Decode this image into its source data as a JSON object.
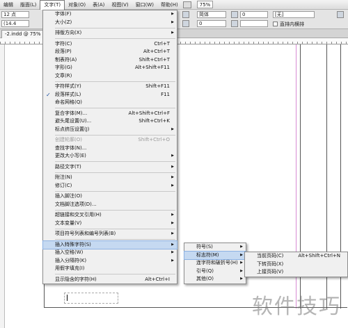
{
  "menubar": {
    "items": [
      "编辑",
      "版面(L)",
      "文字(T)",
      "对象(O)",
      "表(A)",
      "视图(V)",
      "窗口(W)",
      "帮助(H)"
    ],
    "active_index": 2,
    "zoom": "75%"
  },
  "controlbar": {
    "font_size": "12 点",
    "leading": "(14.4",
    "underline_style": "[无]",
    "lang_box": "简体",
    "number_box": "0",
    "ruby_label": "直排内横排",
    "char_style_value": "0"
  },
  "tab": {
    "label": "-2.indd @ 75%"
  },
  "type_menu": {
    "items": [
      {
        "label": "字体(F)",
        "shortcut": "",
        "submenu": true
      },
      {
        "label": "大小(Z)",
        "shortcut": "",
        "submenu": true
      },
      {
        "sep": true
      },
      {
        "label": "排版方向(X)",
        "shortcut": "",
        "submenu": true
      },
      {
        "sep": true
      },
      {
        "label": "字符(C)",
        "shortcut": "Ctrl+T"
      },
      {
        "label": "段落(P)",
        "shortcut": "Alt+Ctrl+T"
      },
      {
        "label": "制表符(A)",
        "shortcut": "Shift+Ctrl+T"
      },
      {
        "label": "字形(G)",
        "shortcut": "Alt+Shift+F11"
      },
      {
        "label": "文章(R)",
        "shortcut": ""
      },
      {
        "sep": true
      },
      {
        "label": "字符样式(Y)",
        "shortcut": "Shift+F11"
      },
      {
        "label": "段落样式(L)",
        "shortcut": "F11",
        "checked": true
      },
      {
        "label": "命名网格(Q)",
        "shortcut": ""
      },
      {
        "sep": true
      },
      {
        "label": "复合字体(M)...",
        "shortcut": "Alt+Shift+Ctrl+F"
      },
      {
        "label": "避头尾设置(U)...",
        "shortcut": "Shift+Ctrl+K"
      },
      {
        "label": "标点挤压设置(J)",
        "shortcut": "",
        "submenu": true
      },
      {
        "sep": true
      },
      {
        "label": "创建轮廓(O)",
        "shortcut": "Shift+Ctrl+O",
        "disabled": true
      },
      {
        "label": "查找字体(N)...",
        "shortcut": ""
      },
      {
        "label": "更改大小写(E)",
        "shortcut": "",
        "submenu": true
      },
      {
        "sep": true
      },
      {
        "label": "路径文字(T)",
        "shortcut": "",
        "submenu": true
      },
      {
        "sep": true
      },
      {
        "label": "附注(N)",
        "shortcut": "",
        "submenu": true
      },
      {
        "label": "修订(C)",
        "shortcut": "",
        "submenu": true
      },
      {
        "sep": true
      },
      {
        "label": "插入脚注(O)",
        "shortcut": ""
      },
      {
        "label": "文档脚注选项(D)...",
        "shortcut": ""
      },
      {
        "sep": true
      },
      {
        "label": "超链接和交叉引用(H)",
        "shortcut": "",
        "submenu": true
      },
      {
        "label": "文本变量(V)",
        "shortcut": "",
        "submenu": true
      },
      {
        "sep": true
      },
      {
        "label": "项目符号列表和编号列表(B)",
        "shortcut": "",
        "submenu": true
      },
      {
        "sep": true
      },
      {
        "label": "插入特殊字符(S)",
        "shortcut": "",
        "submenu": true,
        "highlight": true
      },
      {
        "label": "插入空格(W)",
        "shortcut": "",
        "submenu": true
      },
      {
        "label": "插入分隔符(K)",
        "shortcut": "",
        "submenu": true
      },
      {
        "label": "用假字填充(I)",
        "shortcut": ""
      },
      {
        "sep": true
      },
      {
        "label": "显示隐含的字符(H)",
        "shortcut": "Alt+Ctrl+I"
      }
    ]
  },
  "special_char_menu": {
    "items": [
      {
        "label": "符号(S)",
        "submenu": true
      },
      {
        "label": "标志符(M)",
        "submenu": true,
        "highlight": true
      },
      {
        "label": "连字符和破折号(H)",
        "submenu": true
      },
      {
        "label": "引号(Q)",
        "submenu": true
      },
      {
        "label": "其他(O)",
        "submenu": true
      }
    ]
  },
  "marker_menu": {
    "items": [
      {
        "label": "当前页码(C)",
        "shortcut": "Alt+Shift+Ctrl+N"
      },
      {
        "label": "下转页码(X)",
        "shortcut": ""
      },
      {
        "label": "上接页码(V)",
        "shortcut": ""
      }
    ]
  },
  "watermark": "软件技巧"
}
